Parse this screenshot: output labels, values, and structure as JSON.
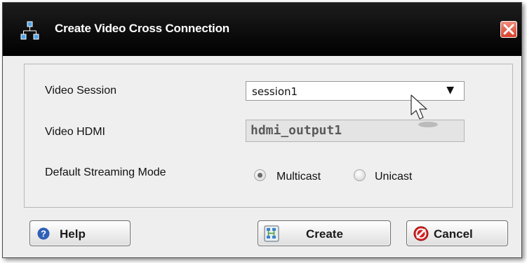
{
  "dialog": {
    "title": "Create Video Cross Connection",
    "icon": "network-icon",
    "close_icon": "close-icon"
  },
  "form": {
    "video_session": {
      "label": "Video Session",
      "value": "session1"
    },
    "video_hdmi": {
      "label": "Video HDMI",
      "value": "hdmi_output1"
    },
    "streaming_mode": {
      "label": "Default Streaming Mode",
      "options": [
        {
          "label": "Multicast",
          "selected": true
        },
        {
          "label": "Unicast",
          "selected": false
        }
      ]
    }
  },
  "buttons": {
    "help": {
      "label": "Help",
      "icon": "help-icon"
    },
    "create": {
      "label": "Create",
      "icon": "create-icon"
    },
    "cancel": {
      "label": "Cancel",
      "icon": "cancel-icon"
    }
  },
  "colors": {
    "titlebar": "#000000",
    "close": "#d6402c",
    "help_blue": "#2f5fb7",
    "cancel_red": "#d32222"
  }
}
